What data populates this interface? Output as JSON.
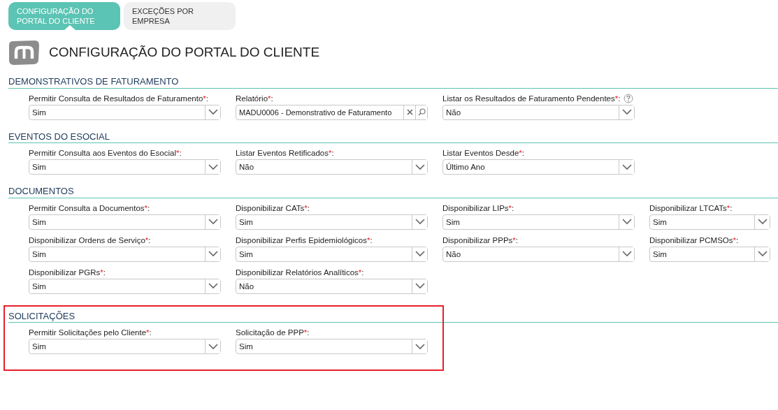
{
  "tabs": [
    {
      "label": "CONFIGURAÇÃO DO PORTAL DO CLIENTE",
      "selected": true
    },
    {
      "label": "EXCEÇÕES POR EMPRESA",
      "selected": false
    }
  ],
  "page_title": "CONFIGURAÇÃO DO PORTAL DO CLIENTE",
  "sections": [
    {
      "title": "DEMONSTRATIVOS DE FATURAMENTO",
      "fields": [
        {
          "kind": "select",
          "label": "Permitir Consulta de Resultados de Faturamento",
          "required_mark": "*",
          "label_end": ":",
          "value": "Sim"
        },
        {
          "kind": "lookup",
          "label": "Relatório",
          "required_mark": "*",
          "label_end": ":",
          "value": "MADU0006 - Demonstrativo de Faturamento"
        },
        {
          "kind": "select",
          "label": "Listar os Resultados de Faturamento Pendentes",
          "required_mark": "*",
          "label_end": ":",
          "value": "Não",
          "help": true
        }
      ]
    },
    {
      "title": "EVENTOS DO ESOCIAL",
      "fields": [
        {
          "kind": "select",
          "label": "Permitir Consulta aos Eventos do Esocial",
          "required_mark": "*",
          "label_end": ":",
          "value": "Sim"
        },
        {
          "kind": "select",
          "label": "Listar Eventos Retificados",
          "required_mark": "*",
          "label_end": ":",
          "value": "Não"
        },
        {
          "kind": "select",
          "label": "Listar Eventos Desde",
          "required_mark": "*",
          "label_end": ":",
          "value": "Último Ano"
        }
      ]
    },
    {
      "title": "DOCUMENTOS",
      "fields": [
        {
          "kind": "select",
          "label": "Permitir Consulta a Documentos",
          "required_mark": "*",
          "label_end": ":",
          "value": "Sim"
        },
        {
          "kind": "select",
          "label": "Disponibilizar CATs",
          "required_mark": "*",
          "label_end": ":",
          "value": "Sim"
        },
        {
          "kind": "select",
          "label": "Disponibilizar LIPs",
          "required_mark": "*",
          "label_end": ":",
          "value": "Sim"
        },
        {
          "kind": "select",
          "label": "Disponibilizar LTCATs",
          "required_mark": "*",
          "label_end": ":",
          "value": "Sim"
        },
        {
          "kind": "select",
          "label": "Disponibilizar Ordens de Serviço",
          "required_mark": "*",
          "label_end": ":",
          "value": "Sim"
        },
        {
          "kind": "select",
          "label": "Disponibilizar Perfis Epidemiológicos",
          "required_mark": "*",
          "label_end": ":",
          "value": "Sim"
        },
        {
          "kind": "select",
          "label": "Disponibilizar PPPs",
          "required_mark": "*",
          "label_end": ":",
          "value": "Não"
        },
        {
          "kind": "select",
          "label": "Disponibilizar PCMSOs",
          "required_mark": "*",
          "label_end": ":",
          "value": "Sim"
        },
        {
          "kind": "select",
          "label": "Disponibilizar PGRs",
          "required_mark": "*",
          "label_end": ":",
          "value": "Sim"
        },
        {
          "kind": "select",
          "label": "Disponibilizar Relatórios Analíticos",
          "required_mark": "*",
          "label_end": ":",
          "value": "Não"
        }
      ]
    },
    {
      "title": "SOLICITAÇÕES",
      "highlighted": true,
      "fields": [
        {
          "kind": "select",
          "label": "Permitir Solicitações pelo Cliente",
          "required_mark": "*",
          "label_end": ":",
          "value": "Sim"
        },
        {
          "kind": "select",
          "label": "Solicitação de PPP",
          "required_mark": "*",
          "label_end": ":",
          "value": "Sim"
        }
      ]
    }
  ]
}
